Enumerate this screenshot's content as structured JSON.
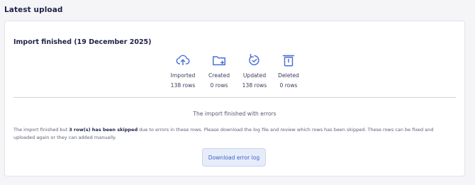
{
  "section": {
    "title": "Latest upload"
  },
  "import": {
    "title": "Import finished (19 December 2025)",
    "stats": [
      {
        "icon": "cloud-upload-icon",
        "label": "Imported",
        "value": "138 rows"
      },
      {
        "icon": "folder-plus-icon",
        "label": "Created",
        "value": "0 rows"
      },
      {
        "icon": "refresh-icon",
        "label": "Updated",
        "value": "138 rows"
      },
      {
        "icon": "trash-icon",
        "label": "Deleted",
        "value": "0 rows"
      }
    ],
    "status": "The import finished with errors",
    "message_pre": "The import finished but ",
    "message_bold": "3 row(s) has been skipped",
    "message_post": " due to errors in these rows. Please download the log file and review which rows has been skipped. These rows can be fixed and uploaded again or they can added manually.",
    "download_label": "Download error log"
  },
  "colors": {
    "accent": "#3a61d1",
    "icon": "#4a6fd8",
    "title": "#1e2247",
    "button_bg": "#e7ecf9"
  }
}
